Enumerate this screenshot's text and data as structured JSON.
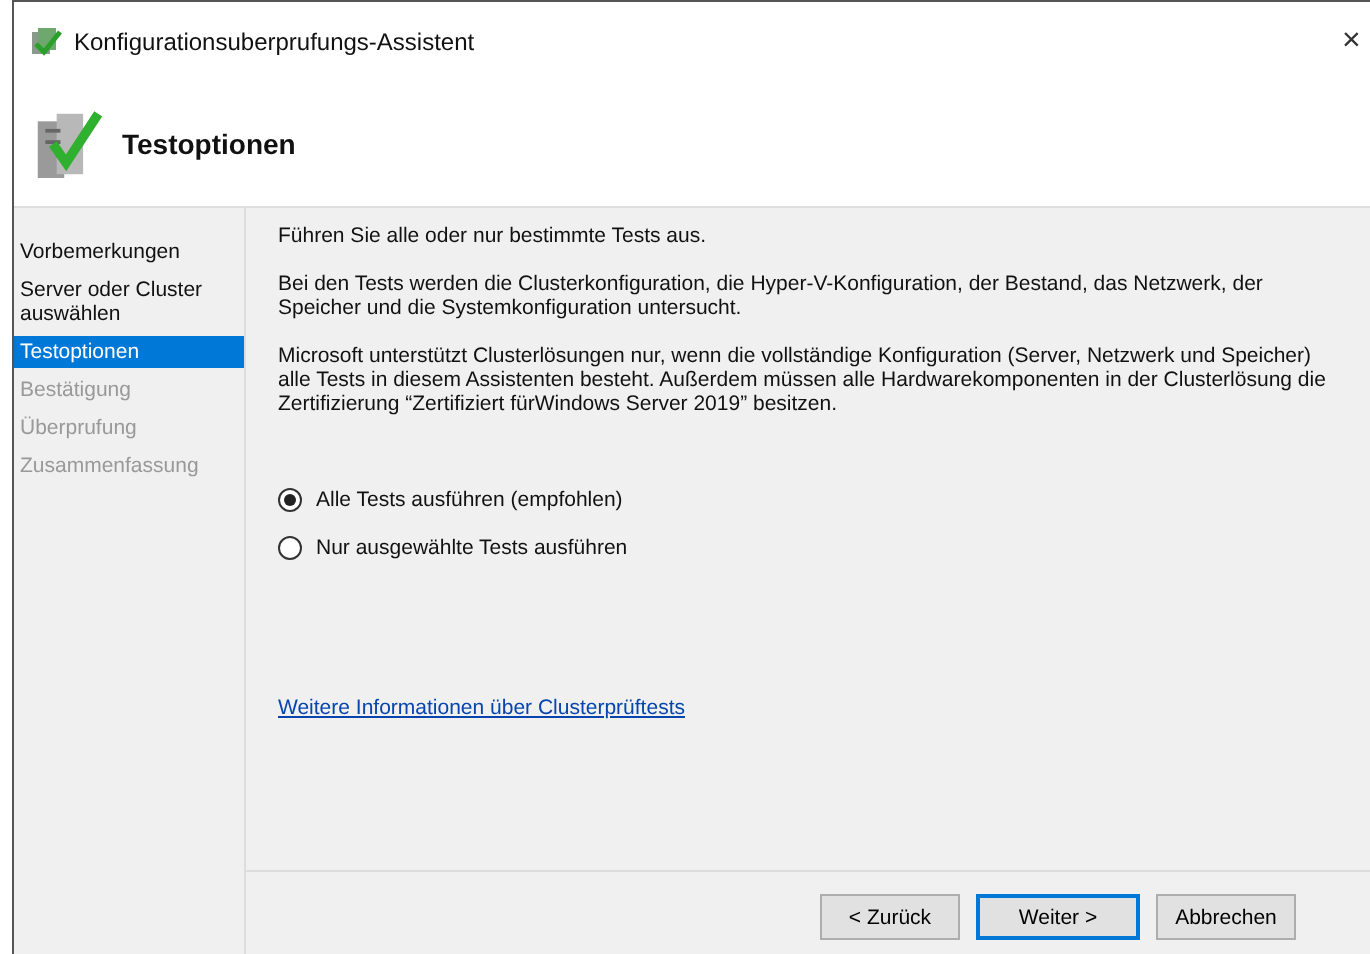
{
  "window": {
    "title": "Konfigurationsuberprufungs-Assistent",
    "close": "×"
  },
  "header": {
    "title": "Testoptionen"
  },
  "sidebar": {
    "items": [
      {
        "label": "Vorbemerkungen",
        "selected": false,
        "disabled": false
      },
      {
        "label": "Server oder Cluster auswählen",
        "selected": false,
        "disabled": false
      },
      {
        "label": "Testoptionen",
        "selected": true,
        "disabled": false
      },
      {
        "label": "Bestätigung",
        "selected": false,
        "disabled": true
      },
      {
        "label": "Überprufung",
        "selected": false,
        "disabled": true
      },
      {
        "label": "Zusammenfassung",
        "selected": false,
        "disabled": true
      }
    ]
  },
  "content": {
    "paragraphs": [
      "Führen Sie alle oder nur bestimmte Tests aus.",
      "Bei den Tests werden die Clusterkonfiguration, die Hyper-V-Konfiguration, der Bestand, das Netzwerk, der Speicher und die Systemkonfiguration untersucht.",
      "Microsoft unterstützt Clusterlösungen nur, wenn die vollständige Konfiguration (Server, Netzwerk und Speicher) alle Tests in diesem Assistenten besteht. Außerdem müssen alle Hardwarekomponenten in der Clusterlösung die Zertifizierung “Zertifiziert fürWindows Server 2019” besitzen."
    ],
    "options": [
      {
        "label": "Alle Tests ausführen (empfohlen)",
        "selected": true
      },
      {
        "label": "Nur ausgewählte Tests ausführen",
        "selected": false
      }
    ],
    "link": "Weitere Informationen über Clusterprüftests"
  },
  "buttons": [
    {
      "label": "< Zurück",
      "default": false
    },
    {
      "label": "Weiter >",
      "default": true
    },
    {
      "label": "Abbrechen",
      "default": false
    }
  ]
}
